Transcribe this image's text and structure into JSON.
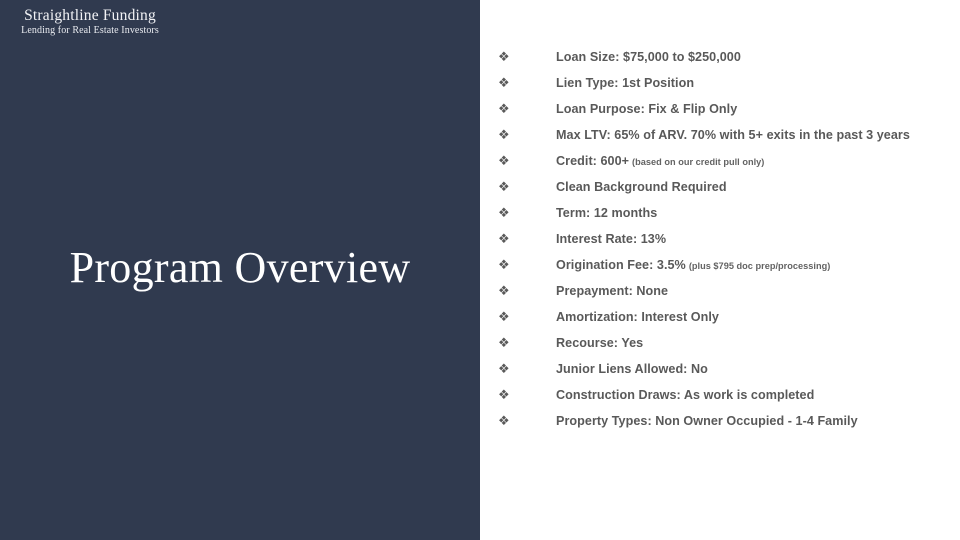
{
  "theme": {
    "panel_color": "#303a4f",
    "background_color": "#ffffff",
    "title_color": "#ffffff",
    "body_text_color": "#595959"
  },
  "logo": {
    "name": "Straightline Funding",
    "tagline": "Lending for Real Estate Investors"
  },
  "title": "Program Overview",
  "bullet_marker": "❖",
  "bullets": [
    {
      "text": "Loan Size:  $75,000 to $250,000",
      "note": ""
    },
    {
      "text": "Lien Type:  1st Position",
      "note": ""
    },
    {
      "text": "Loan Purpose:  Fix & Flip Only",
      "note": ""
    },
    {
      "text": "Max LTV:  65% of ARV.  70% with 5+ exits in the past 3 years",
      "note": ""
    },
    {
      "text": "Credit:  600+",
      "note": "(based on our credit pull only)"
    },
    {
      "text": "Clean Background Required",
      "note": ""
    },
    {
      "text": "Term:  12 months",
      "note": ""
    },
    {
      "text": "Interest Rate:  13%",
      "note": ""
    },
    {
      "text": "Origination Fee:  3.5%",
      "note": "(plus $795 doc prep/processing)"
    },
    {
      "text": "Prepayment:  None",
      "note": ""
    },
    {
      "text": "Amortization:  Interest Only",
      "note": ""
    },
    {
      "text": "Recourse:  Yes",
      "note": ""
    },
    {
      "text": "Junior Liens Allowed:  No",
      "note": ""
    },
    {
      "text": "Construction Draws:  As work is completed",
      "note": ""
    },
    {
      "text": "Property Types:  Non Owner Occupied - 1-4 Family",
      "note": ""
    }
  ]
}
